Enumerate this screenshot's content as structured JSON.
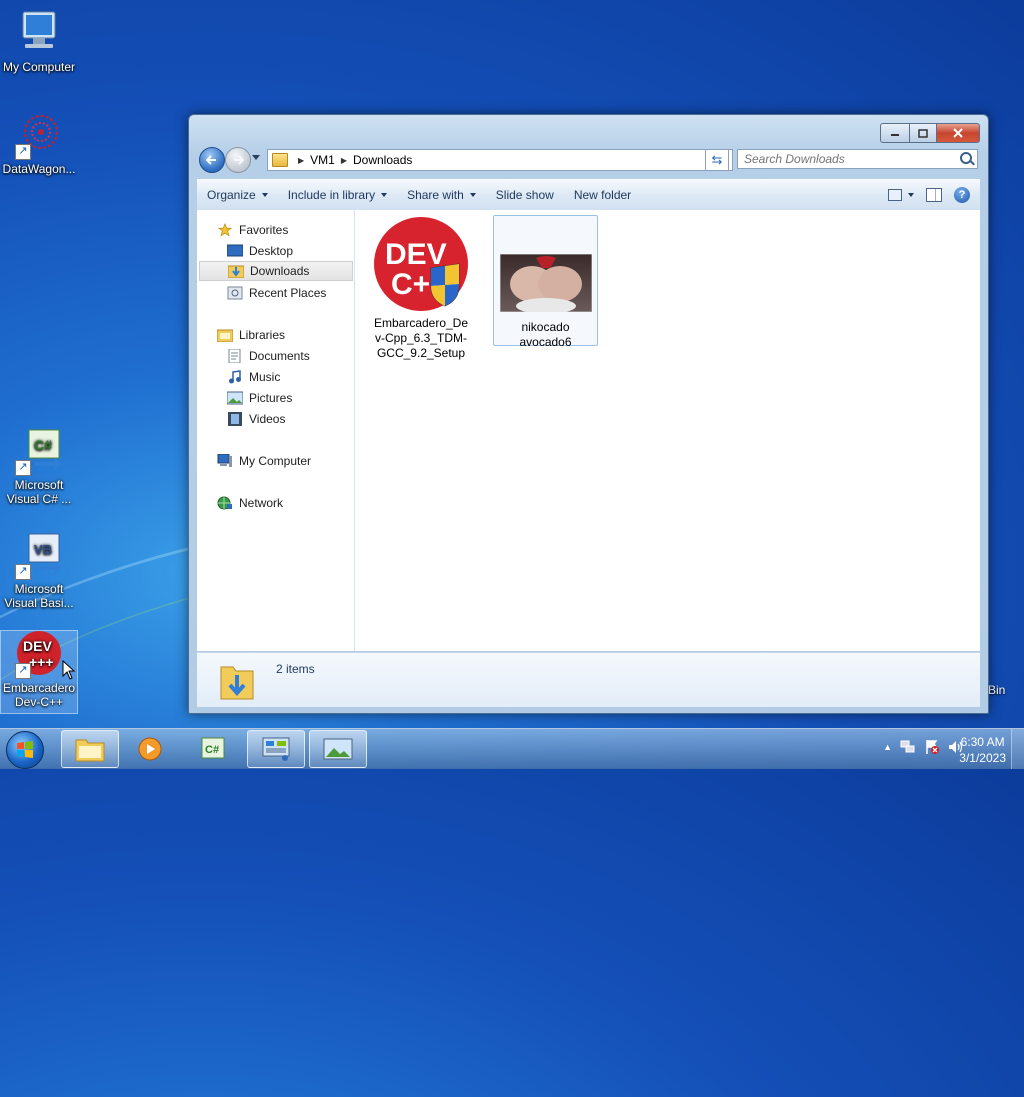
{
  "desktop": {
    "icons": [
      {
        "label": "My Computer"
      },
      {
        "label": "DataWagon..."
      },
      {
        "label": "Microsoft Visual C# ..."
      },
      {
        "label": "Microsoft Visual Basi..."
      },
      {
        "label": "Embarcadero Dev-C++"
      }
    ],
    "recycle_bin_partial": "Bin"
  },
  "window": {
    "address": {
      "root": "VM1",
      "current": "Downloads"
    },
    "search": {
      "placeholder": "Search Downloads"
    },
    "toolbar": {
      "organize": "Organize",
      "include": "Include in library",
      "share": "Share with",
      "slideshow": "Slide show",
      "new_folder": "New folder"
    },
    "nav": {
      "favorites": "Favorites",
      "desktop": "Desktop",
      "downloads": "Downloads",
      "recent": "Recent Places",
      "libraries": "Libraries",
      "documents": "Documents",
      "music": "Music",
      "pictures": "Pictures",
      "videos": "Videos",
      "computer": "My Computer",
      "network": "Network"
    },
    "files": [
      {
        "name": "Embarcadero_Dev-Cpp_6.3_TDM-GCC_9.2_Setup",
        "line1": "Embarcadero_De",
        "line2": "v-Cpp_6.3_TDM-",
        "line3": "GCC_9.2_Setup",
        "icon_text_1": "DEV",
        "icon_text_2": "C+"
      },
      {
        "name": "nikocado avocado6",
        "line1": "nikocado",
        "line2": "avocado6"
      }
    ],
    "details": {
      "count": "2 items"
    }
  },
  "taskbar": {
    "time": "6:30 AM",
    "date": "3/1/2023"
  },
  "colors": {
    "accent": "#1f6fd0",
    "selection": "#9dc0e5"
  }
}
